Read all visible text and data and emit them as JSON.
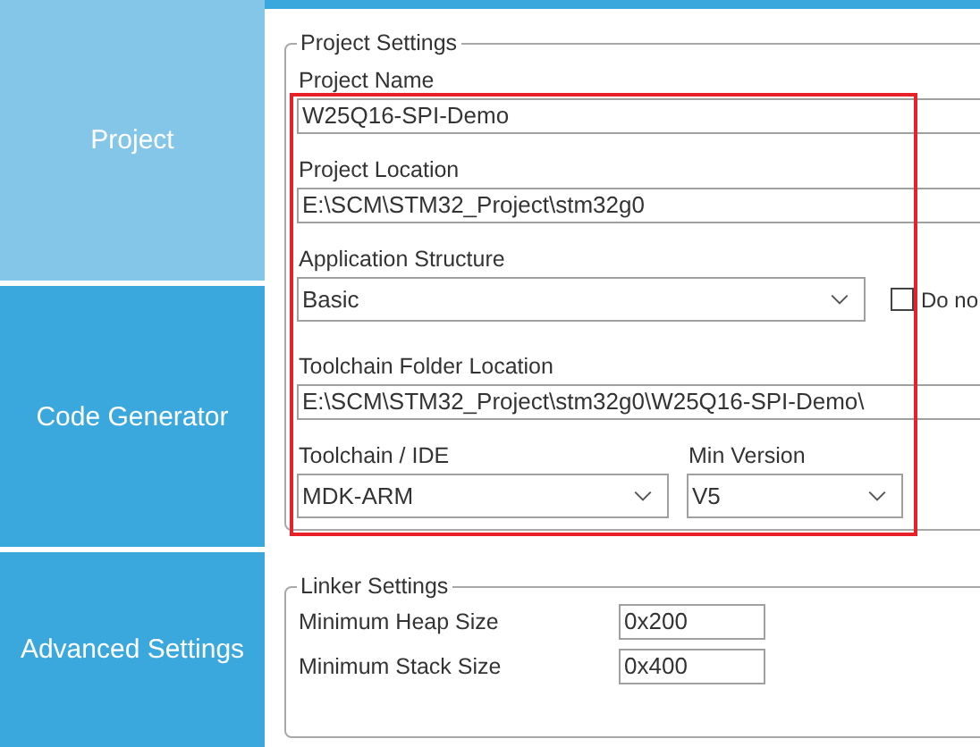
{
  "sidebar": {
    "items": [
      {
        "label": "Project",
        "selected": true
      },
      {
        "label": "Code Generator",
        "selected": false
      },
      {
        "label": "Advanced Settings",
        "selected": false
      }
    ]
  },
  "project_settings": {
    "title": "Project Settings",
    "project_name": {
      "label": "Project Name",
      "value": "W25Q16-SPI-Demo"
    },
    "project_location": {
      "label": "Project Location",
      "value": "E:\\SCM\\STM32_Project\\stm32g0"
    },
    "application_structure": {
      "label": "Application Structure",
      "value": "Basic",
      "option": {
        "label": "Do no",
        "checked": false
      }
    },
    "toolchain_folder": {
      "label": "Toolchain Folder Location",
      "value": "E:\\SCM\\STM32_Project\\stm32g0\\W25Q16-SPI-Demo\\"
    },
    "toolchain": {
      "label": "Toolchain / IDE",
      "value": "MDK-ARM"
    },
    "min_version": {
      "label": "Min Version",
      "value": "V5"
    }
  },
  "linker_settings": {
    "title": "Linker Settings",
    "rows": [
      {
        "label": "Minimum Heap Size",
        "value": "0x200"
      },
      {
        "label": "Minimum Stack Size",
        "value": "0x400"
      }
    ]
  },
  "annotation": {
    "kind": "frame"
  }
}
